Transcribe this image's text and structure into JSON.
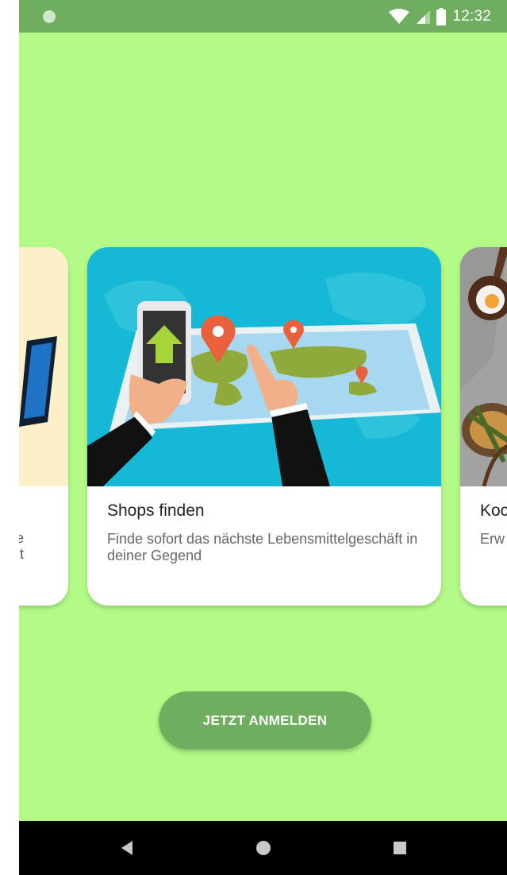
{
  "status_bar": {
    "time": "12:32",
    "icons": [
      "notification-dot-icon",
      "wifi-icon",
      "signal-icon",
      "battery-icon"
    ]
  },
  "cards": [
    {
      "id": "left",
      "partial": true,
      "visible_text_fragments": [
        "e",
        "t"
      ],
      "image_background": "#fbf0c7"
    },
    {
      "id": "center",
      "title": "Shops finden",
      "description": "Finde sofort das nächste Lebensmittelgeschäft in deiner Gegend",
      "image": "map-with-phone-and-pins-illustration"
    },
    {
      "id": "right",
      "partial": true,
      "title_fragment": "Koc",
      "description_fragment": "Erw",
      "image": "food-on-stone-photo"
    }
  ],
  "login_button": {
    "label": "JETZT ANMELDEN"
  },
  "colors": {
    "background": "#b3fa87",
    "accent": "#6fae5e",
    "status_bar": "#6fae5e"
  },
  "nav_bar": {
    "buttons": [
      "back-icon",
      "home-icon",
      "recents-icon"
    ]
  }
}
